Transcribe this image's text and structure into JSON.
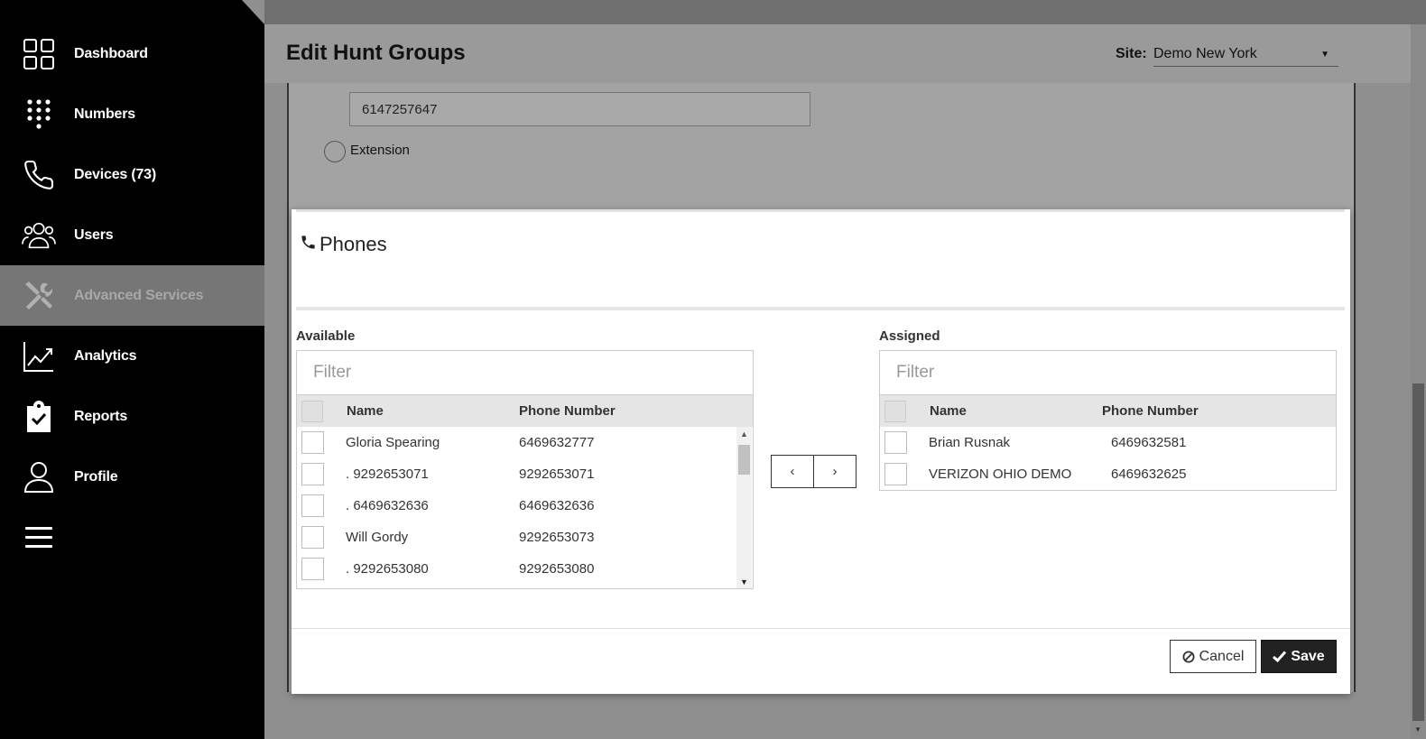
{
  "sidebar": {
    "items": [
      {
        "label": "Dashboard",
        "icon": "dashboard-icon"
      },
      {
        "label": "Numbers",
        "icon": "keypad-icon"
      },
      {
        "label": "Devices (73)",
        "icon": "phone-icon"
      },
      {
        "label": "Users",
        "icon": "users-icon"
      },
      {
        "label": "Advanced Services",
        "icon": "tools-icon",
        "active": true
      },
      {
        "label": "Analytics",
        "icon": "analytics-icon"
      },
      {
        "label": "Reports",
        "icon": "reports-icon"
      },
      {
        "label": "Profile",
        "icon": "profile-icon"
      },
      {
        "label": "",
        "icon": "menu-icon"
      }
    ]
  },
  "header": {
    "title": "Edit Hunt Groups",
    "site_label": "Site:",
    "site_value": "Demo New York"
  },
  "background_form": {
    "number_value": "6147257647",
    "extension_label": "Extension"
  },
  "modal": {
    "title": "Phones",
    "available": {
      "label": "Available",
      "filter_placeholder": "Filter",
      "columns": {
        "name": "Name",
        "phone": "Phone Number"
      },
      "rows": [
        {
          "name": "Gloria Spearing",
          "phone": "6469632777"
        },
        {
          "name": ". 9292653071",
          "phone": "9292653071"
        },
        {
          "name": ". 6469632636",
          "phone": "6469632636"
        },
        {
          "name": "Will Gordy",
          "phone": "9292653073"
        },
        {
          "name": ". 9292653080",
          "phone": "9292653080"
        }
      ]
    },
    "assigned": {
      "label": "Assigned",
      "filter_placeholder": "Filter",
      "columns": {
        "name": "Name",
        "phone": "Phone Number"
      },
      "rows": [
        {
          "name": "Brian Rusnak",
          "phone": "6469632581"
        },
        {
          "name": "VERIZON OHIO DEMO",
          "phone": "6469632625"
        }
      ]
    },
    "move_left": "‹",
    "move_right": "›",
    "cancel_label": "Cancel",
    "save_label": "Save"
  },
  "colors": {
    "sidebar_bg": "#000000",
    "active_item_bg": "#767676",
    "save_bg": "#222222"
  }
}
